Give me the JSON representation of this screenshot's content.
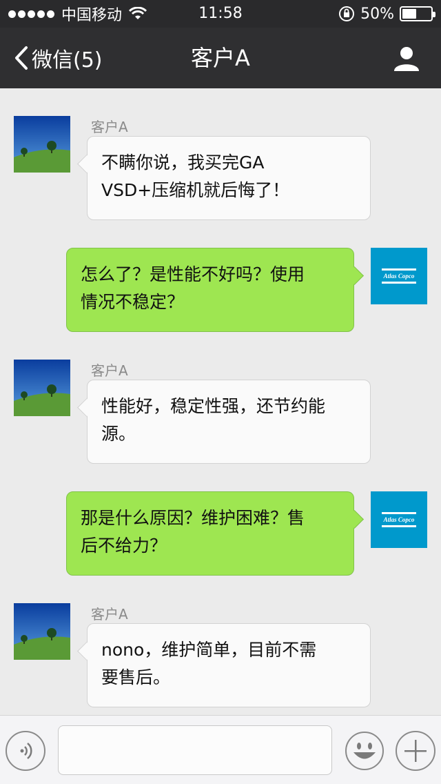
{
  "status_bar": {
    "carrier": "中国移动",
    "time": "11:58",
    "battery_text": "50%",
    "battery_level": 0.5
  },
  "nav": {
    "back_label": "微信(5)",
    "title": "客户A"
  },
  "messages": [
    {
      "side": "left",
      "sender": "客户A",
      "lines": [
        "不瞒你说，我买完GA",
        "VSD+压缩机就后悔了！"
      ]
    },
    {
      "side": "right",
      "lines": [
        "怎么了？是性能不好吗？使用",
        "情况不稳定？"
      ]
    },
    {
      "side": "left",
      "sender": "客户A",
      "lines": [
        "性能好，稳定性强，还节约能",
        "源。"
      ]
    },
    {
      "side": "right",
      "lines": [
        "那是什么原因？维护困难？售",
        "后不给力？"
      ]
    },
    {
      "side": "left",
      "sender": "客户A",
      "lines": [
        "nono，维护简单，目前不需",
        "要售后。"
      ]
    }
  ],
  "brand": {
    "logo_text": "Atlas Copco",
    "logo_color": "#0099cc"
  },
  "colors": {
    "nav_bg": "#2f2f31",
    "outgoing_bubble": "#9ee651",
    "incoming_bubble": "#fafafa",
    "chat_bg": "#ebebeb"
  }
}
